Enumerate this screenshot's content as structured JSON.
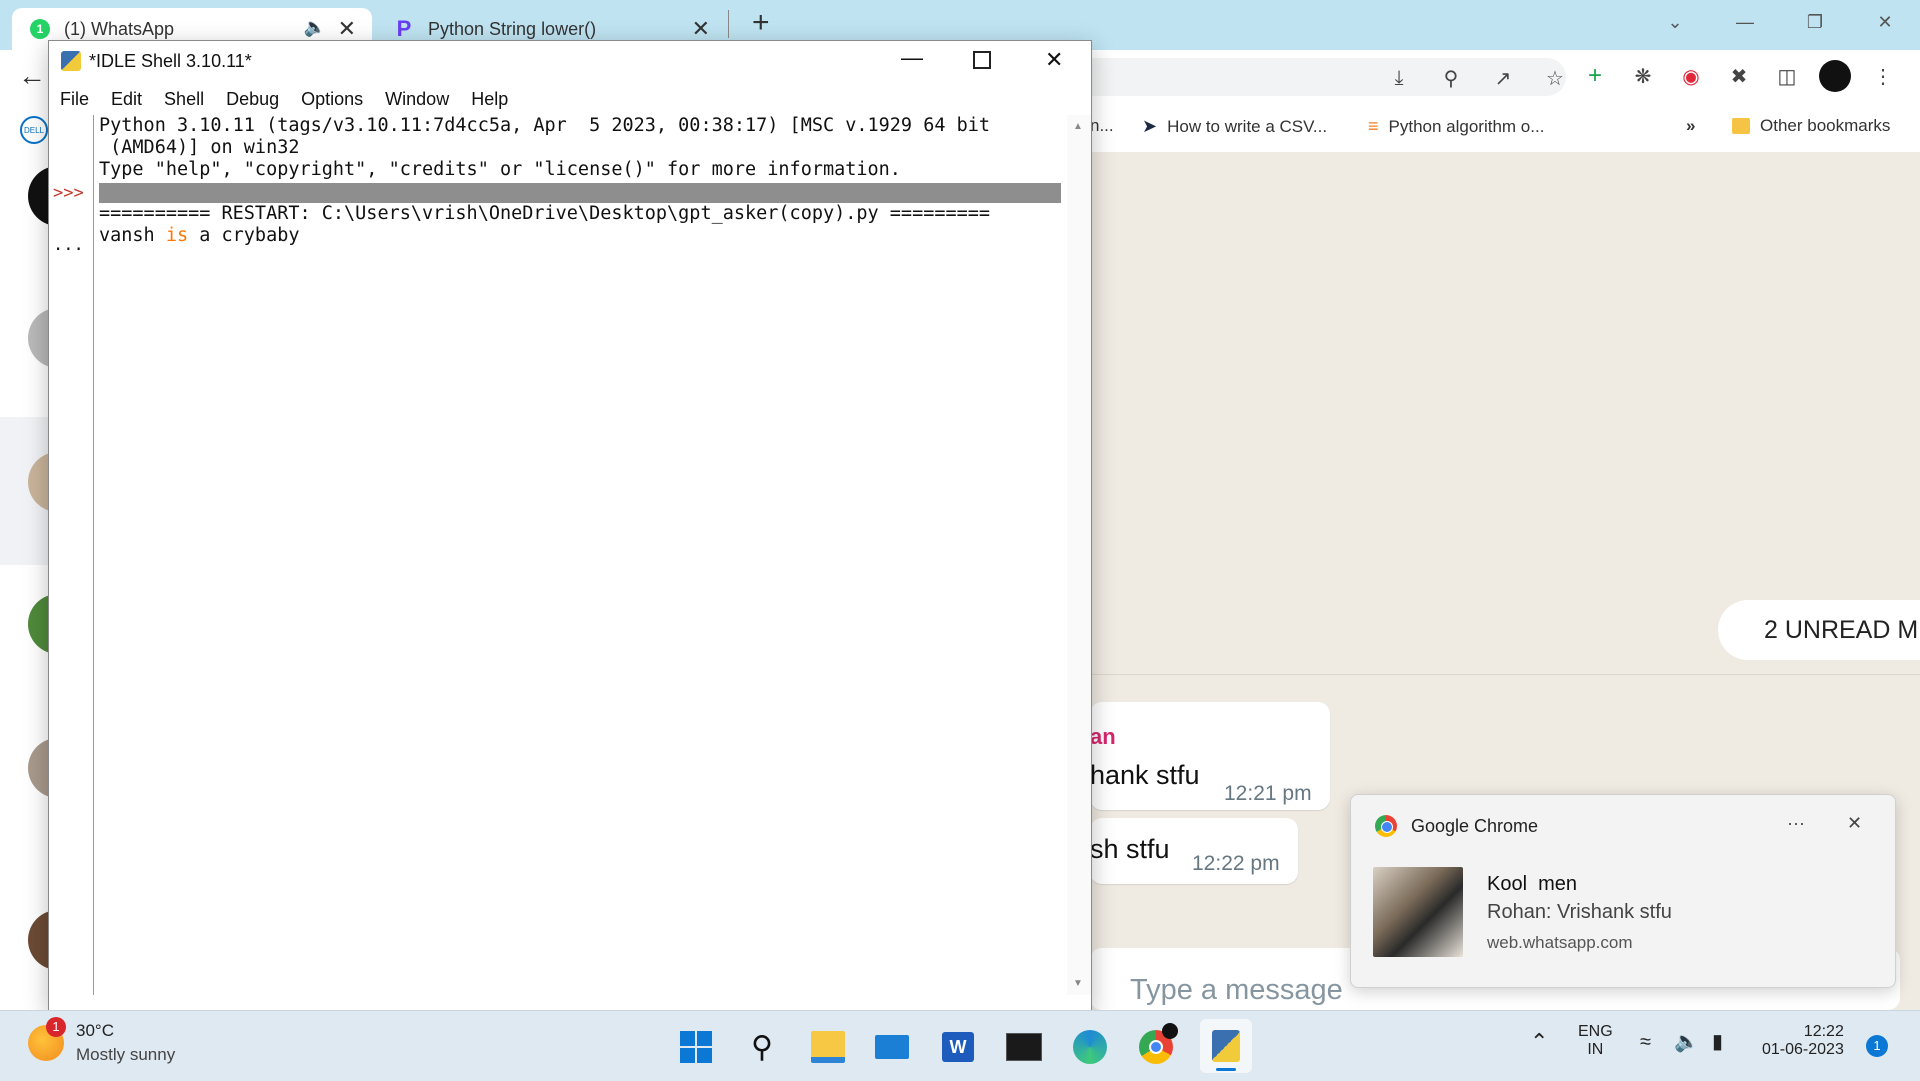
{
  "browser": {
    "tabs": [
      {
        "label": "(1) WhatsApp",
        "badge": "1",
        "audio_icon": "speaker-icon"
      },
      {
        "label": "Python String lower()"
      }
    ],
    "bookmarks": [
      {
        "label": "n..."
      },
      {
        "label": "How to write a CSV..."
      },
      {
        "label": "Python algorithm o..."
      },
      {
        "label": "»"
      },
      {
        "label": "Other bookmarks"
      }
    ]
  },
  "whatsapp": {
    "unread_banner": "2 UNREAD M",
    "messages": [
      {
        "sender": "an",
        "text": "hank stfu",
        "time": "12:21 pm"
      },
      {
        "text": "sh stfu",
        "time": "12:22 pm"
      }
    ],
    "composer_placeholder": "Type a message"
  },
  "notification": {
    "app": "Google Chrome",
    "more": "···",
    "title": "Kool  men",
    "body": "Rohan: Vrishank stfu",
    "source": "web.whatsapp.com"
  },
  "idle": {
    "title": "*IDLE Shell 3.10.11*",
    "menu": [
      "File",
      "Edit",
      "Shell",
      "Debug",
      "Options",
      "Window",
      "Help"
    ],
    "prompt": ">>>",
    "continuation": "...",
    "lines": {
      "banner1": "Python 3.10.11 (tags/v3.10.11:7d4cc5a, Apr  5 2023, 00:38:17) [MSC v.1929 64 bit",
      "banner2": " (AMD64)] on win32",
      "banner3": "Type \"help\", \"copyright\", \"credits\" or \"license()\" for more information.",
      "restart": "========== RESTART: C:\\Users\\vrish\\OneDrive\\Desktop\\gpt_asker(copy).py =========",
      "out_word1": "vansh ",
      "out_kw": "is",
      "out_word2": " a crybaby"
    }
  },
  "taskbar": {
    "weather_temp": "30°C",
    "weather_desc": "Mostly sunny",
    "weather_badge": "1",
    "lang1": "ENG",
    "lang2": "IN",
    "time": "12:22",
    "date": "01-06-2023",
    "notif_count": "1"
  }
}
